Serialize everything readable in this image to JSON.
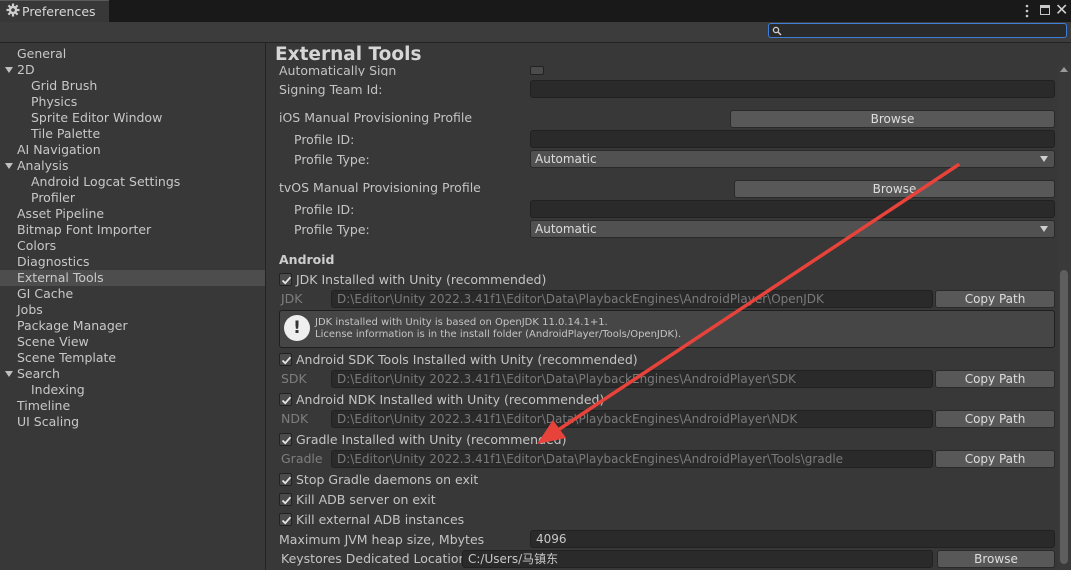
{
  "window": {
    "tab_title": "Preferences"
  },
  "search": {
    "value": ""
  },
  "sidebar": {
    "items": [
      {
        "label": "General"
      },
      {
        "label": "2D"
      },
      {
        "label": "Grid Brush"
      },
      {
        "label": "Physics"
      },
      {
        "label": "Sprite Editor Window"
      },
      {
        "label": "Tile Palette"
      },
      {
        "label": "AI Navigation"
      },
      {
        "label": "Analysis"
      },
      {
        "label": "Android Logcat Settings"
      },
      {
        "label": "Profiler"
      },
      {
        "label": "Asset Pipeline"
      },
      {
        "label": "Bitmap Font Importer"
      },
      {
        "label": "Colors"
      },
      {
        "label": "Diagnostics"
      },
      {
        "label": "External Tools"
      },
      {
        "label": "GI Cache"
      },
      {
        "label": "Jobs"
      },
      {
        "label": "Package Manager"
      },
      {
        "label": "Scene View"
      },
      {
        "label": "Scene Template"
      },
      {
        "label": "Search"
      },
      {
        "label": "Indexing"
      },
      {
        "label": "Timeline"
      },
      {
        "label": "UI Scaling"
      }
    ],
    "selected": "External Tools"
  },
  "main": {
    "title": "External Tools",
    "auto_sign_label": "Automatically Sign",
    "signing_team_label": "Signing Team Id:",
    "signing_team_value": "",
    "ios": {
      "heading": "iOS Manual Provisioning Profile",
      "browse": "Browse",
      "profile_id_label": "Profile ID:",
      "profile_id_value": "",
      "profile_type_label": "Profile Type:",
      "profile_type_value": "Automatic"
    },
    "tvos": {
      "heading": "tvOS Manual Provisioning Profile",
      "browse": "Browse",
      "profile_id_label": "Profile ID:",
      "profile_id_value": "",
      "profile_type_label": "Profile Type:",
      "profile_type_value": "Automatic"
    },
    "android": {
      "heading": "Android",
      "jdk_check": "JDK Installed with Unity (recommended)",
      "jdk_label": "JDK",
      "jdk_path": "D:\\Editor\\Unity 2022.3.41f1\\Editor\\Data\\PlaybackEngines\\AndroidPlayer\\OpenJDK",
      "copy_path": "Copy Path",
      "jdk_help_1": "JDK installed with Unity is based on OpenJDK 11.0.14.1+1.",
      "jdk_help_2": "License information is in the install folder (AndroidPlayer/Tools/OpenJDK).",
      "sdk_check": "Android SDK Tools Installed with Unity (recommended)",
      "sdk_label": "SDK",
      "sdk_path": "D:\\Editor\\Unity 2022.3.41f1\\Editor\\Data\\PlaybackEngines\\AndroidPlayer\\SDK",
      "ndk_check": "Android NDK Installed with Unity (recommended)",
      "ndk_label": "NDK",
      "ndk_path": "D:\\Editor\\Unity 2022.3.41f1\\Editor\\Data\\PlaybackEngines\\AndroidPlayer\\NDK",
      "gradle_check": "Gradle Installed with Unity (recommended)",
      "gradle_label": "Gradle",
      "gradle_path": "D:\\Editor\\Unity 2022.3.41f1\\Editor\\Data\\PlaybackEngines\\AndroidPlayer\\Tools\\gradle",
      "stop_gradle": "Stop Gradle daemons on exit",
      "kill_adb": "Kill ADB server on exit",
      "kill_external_adb": "Kill external ADB instances",
      "jvm_label": "Maximum JVM heap size, Mbytes",
      "jvm_value": "4096",
      "keystores_label": "Keystores Dedicated Location",
      "keystores_value": "C:/Users/马镇东",
      "keystores_browse": "Browse"
    }
  },
  "colors": {
    "annotation_arrow": "#e8433a",
    "focus_outline": "#3d7fd9"
  }
}
